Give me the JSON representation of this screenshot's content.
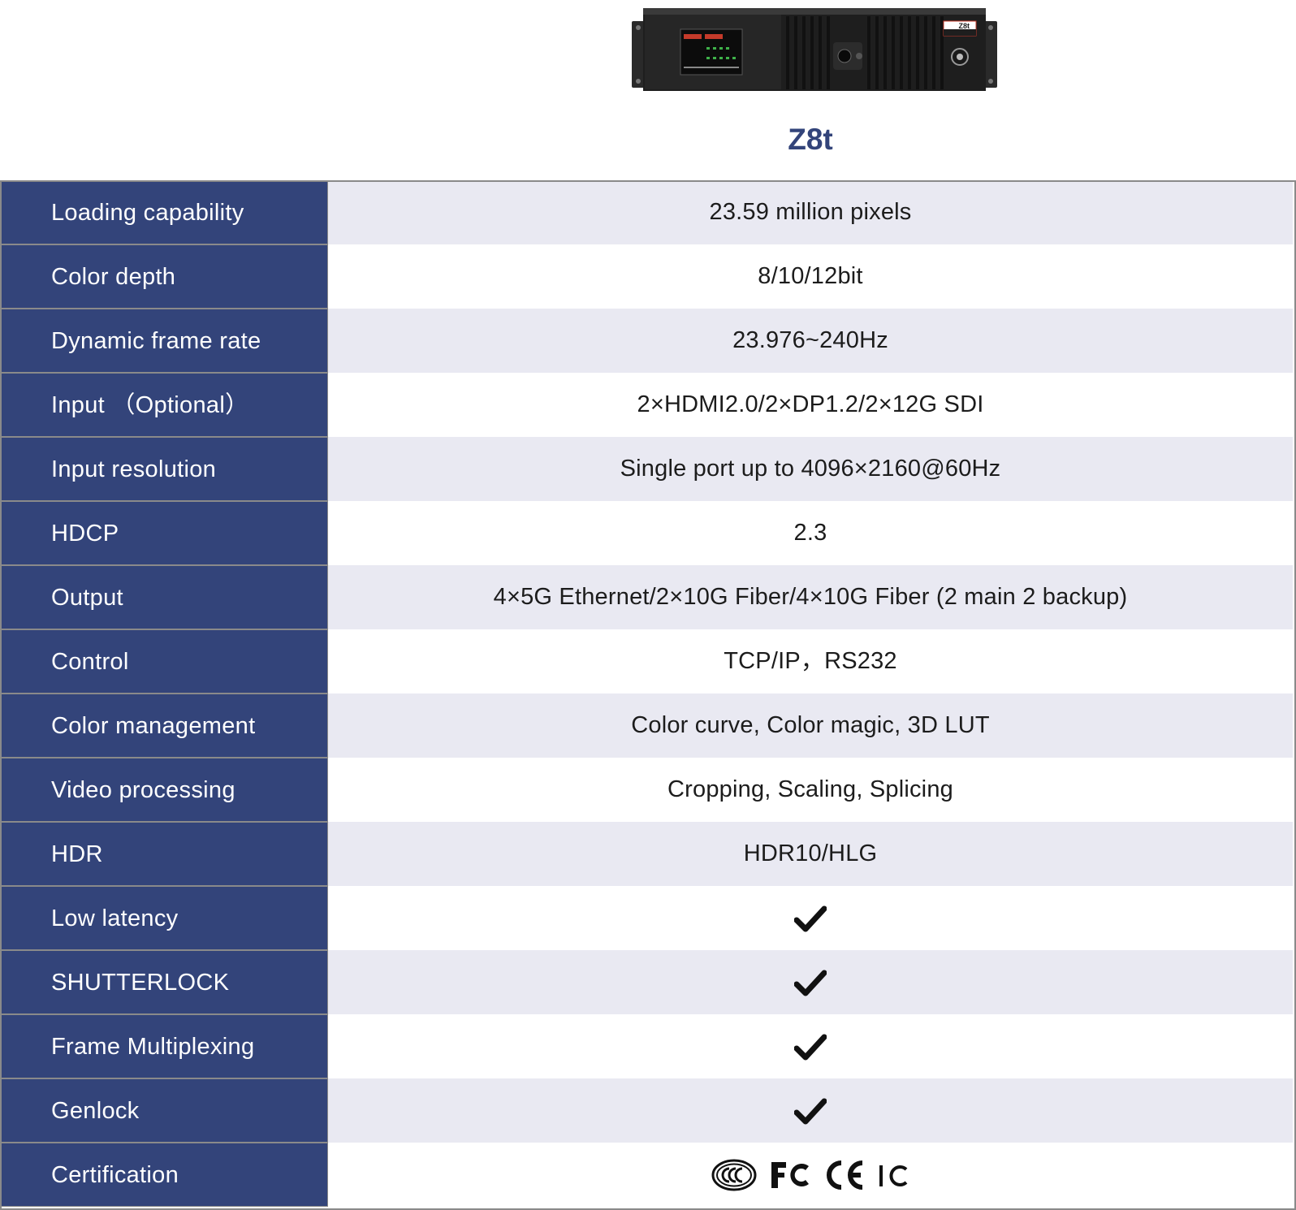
{
  "product": {
    "model": "Z8t",
    "device_image": "rack-mount-video-processor",
    "device_badge": "Z8t"
  },
  "colors": {
    "label_background": "#33447a",
    "shaded_row": "#e9e9f2",
    "model_text": "#33447a"
  },
  "specs": [
    {
      "label": "Loading capability",
      "value": "23.59 million pixels"
    },
    {
      "label": "Color depth",
      "value": "8/10/12bit"
    },
    {
      "label": "Dynamic frame rate",
      "value": "23.976~240Hz"
    },
    {
      "label": "Input （Optional）",
      "value": "2×HDMI2.0/2×DP1.2/2×12G SDI"
    },
    {
      "label": "Input resolution",
      "value": "Single port up to 4096×2160@60Hz"
    },
    {
      "label": "HDCP",
      "value": "2.3"
    },
    {
      "label": "Output",
      "value": "4×5G Ethernet/2×10G Fiber/4×10G Fiber (2 main 2 backup)"
    },
    {
      "label": "Control",
      "value": "TCP/IP，RS232"
    },
    {
      "label": "Color management",
      "value": "Color curve, Color magic, 3D LUT"
    },
    {
      "label": "Video processing",
      "value": "Cropping, Scaling, Splicing"
    },
    {
      "label": "HDR",
      "value": "HDR10/HLG"
    },
    {
      "label": "Low latency",
      "icon": "check-icon"
    },
    {
      "label": "SHUTTERLOCK",
      "icon": "check-icon"
    },
    {
      "label": "Frame Multiplexing",
      "icon": "check-icon"
    },
    {
      "label": "Genlock",
      "icon": "check-icon"
    },
    {
      "label": "Certification",
      "icons": [
        "ccc-mark-icon",
        "fcc-mark-icon",
        "ce-mark-icon",
        "ic-mark-icon"
      ]
    }
  ]
}
